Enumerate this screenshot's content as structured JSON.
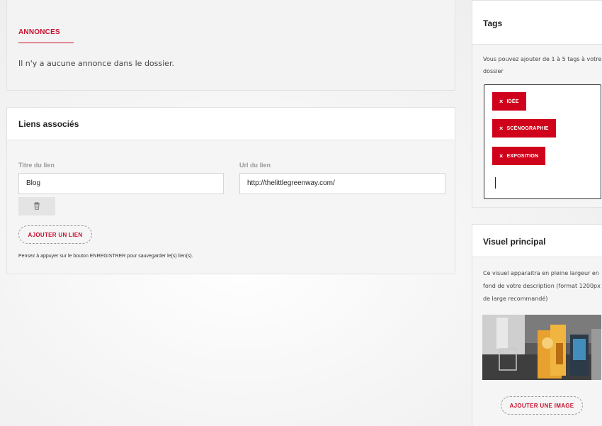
{
  "annonces": {
    "title": "ANNONCES",
    "empty_message": "Il n'y a aucune annonce dans le dossier."
  },
  "liens": {
    "title": "Liens associés",
    "titre_label": "Titre du lien",
    "titre_value": "Blog",
    "url_label": "Url du lien",
    "url_value": "http://thelittlegreenway.com/",
    "trash_icon": "trash-icon",
    "add_button": "AJOUTER UN LIEN",
    "note": "Pensez à appuyer sur le bouton ENREGISTRER pour sauvegarder le(s) lien(s)."
  },
  "tags": {
    "title": "Tags",
    "description": "Vous pouvez ajouter de 1 à 5 tags à votre dossier",
    "items": [
      {
        "label": "IDÉE",
        "remove": "×"
      },
      {
        "label": "SCÉNOGRAPHIE",
        "remove": "×"
      },
      {
        "label": "EXPOSITION",
        "remove": "×"
      }
    ],
    "input_value": ""
  },
  "visuel": {
    "title": "Visuel principal",
    "description": "Ce visuel apparaitra en pleine largeur en fond de votre description (format 1200px de large recommandé)",
    "image_icon": "exhibition-photo",
    "add_button": "AJOUTER UNE IMAGE"
  },
  "colors": {
    "accent": "#c8102e",
    "tag_bg": "#d0021b"
  }
}
